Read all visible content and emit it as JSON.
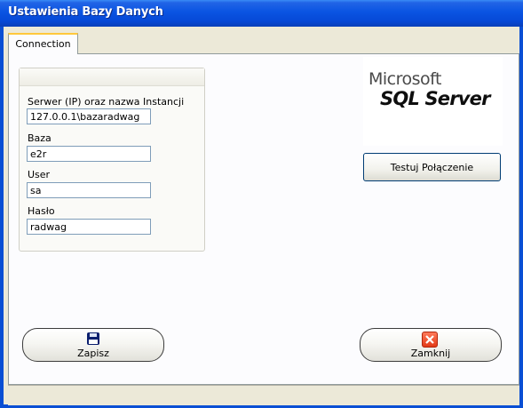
{
  "window": {
    "title": "Ustawienia Bazy Danych"
  },
  "tabs": [
    {
      "label": "Connection"
    }
  ],
  "form": {
    "server_label": "Serwer (IP) oraz nazwa Instancji",
    "server_value": "127.0.0.1\\bazaradwag",
    "database_label": "Baza",
    "database_value": "e2r",
    "user_label": "User",
    "user_value": "sa",
    "password_label": "Hasło",
    "password_value": "radwag"
  },
  "logo": {
    "line1": "Microsoft",
    "line2": "SQL Server"
  },
  "buttons": {
    "test_connection": "Testuj Połączenie",
    "save": "Zapisz",
    "close": "Zamknij"
  },
  "icons": {
    "save": "floppy-disk-icon",
    "close": "red-x-close-icon"
  },
  "colors": {
    "titlebar": "#0a54e2",
    "client": "#ece9d8",
    "tab_highlight": "#ffc83c",
    "input_border": "#7f9db9"
  }
}
